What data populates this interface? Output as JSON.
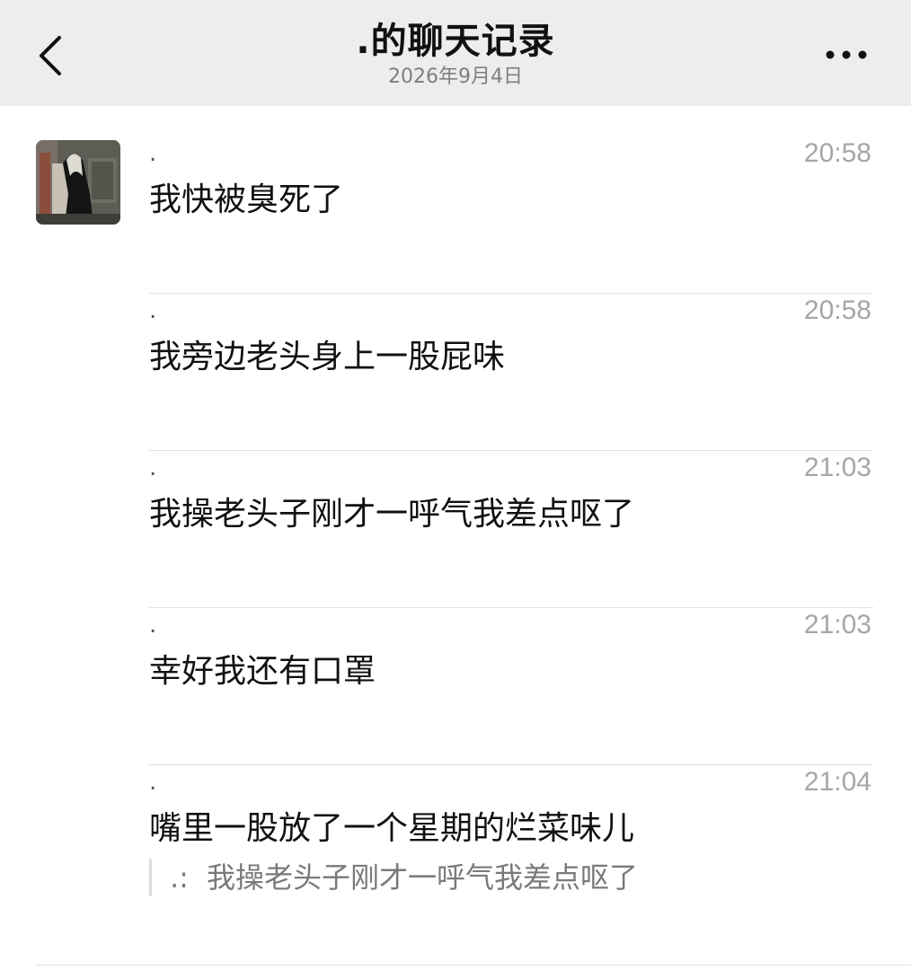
{
  "header": {
    "back_icon": "chevron-left-icon",
    "title": ".的聊天记录",
    "date": "2026年9月4日",
    "more_icon": "more-dots-icon"
  },
  "messages": [
    {
      "sender": ".",
      "time": "20:58",
      "text": "我快被臭死了"
    },
    {
      "sender": ".",
      "time": "20:58",
      "text": "我旁边老头身上一股屁味"
    },
    {
      "sender": ".",
      "time": "21:03",
      "text": "我操老头子刚才一呼气我差点呕了"
    },
    {
      "sender": ".",
      "time": "21:03",
      "text": "幸好我还有口罩"
    },
    {
      "sender": ".",
      "time": "21:04",
      "text": "嘴里一股放了一个星期的烂菜味儿",
      "quote": {
        "sender": ".:",
        "text": "我操老头子刚才一呼气我差点呕了"
      }
    }
  ],
  "colors": {
    "header_bg": "#ededed",
    "time": "#a6a6a6",
    "divider": "#e2e2e2"
  }
}
